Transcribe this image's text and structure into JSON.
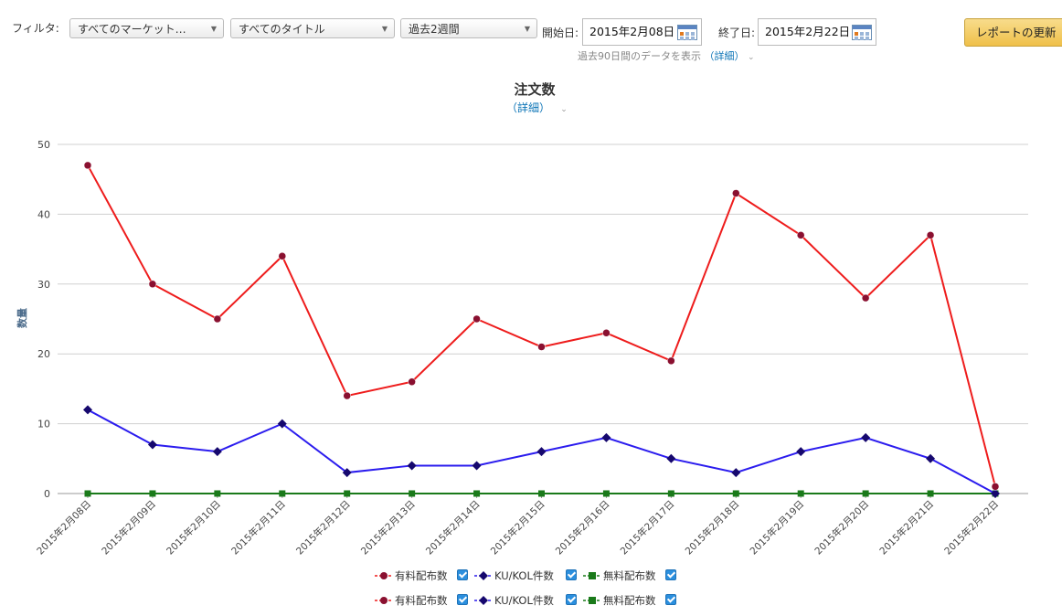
{
  "filters": {
    "label": "フィルタ:",
    "marketplace": "すべてのマーケット…",
    "title": "すべてのタイトル",
    "period": "過去2週間",
    "start_label": "開始日:",
    "start_date": "2015年2月08日",
    "end_label": "終了日:",
    "end_date": "2015年2月22日",
    "update_button": "レポートの更新",
    "note": "過去90日間のデータを表示",
    "details_link": "（詳細）"
  },
  "chart_details_link": "（詳細）",
  "colors": {
    "paid": "#ee1c1c",
    "paid_marker": "#8a1030",
    "ku": "#2b1cee",
    "ku_marker": "#16086e",
    "free": "#1a7a1a"
  },
  "chart_data": {
    "type": "line",
    "title": "注文数",
    "xlabel": "",
    "ylabel": "数量",
    "ylim": [
      0,
      50
    ],
    "yticks": [
      "0",
      "10",
      "20",
      "30",
      "40",
      "50"
    ],
    "grid": true,
    "legend_position": "bottom",
    "x": [
      "2015年2月08日",
      "2015年2月09日",
      "2015年2月10日",
      "2015年2月11日",
      "2015年2月12日",
      "2015年2月13日",
      "2015年2月14日",
      "2015年2月15日",
      "2015年2月16日",
      "2015年2月17日",
      "2015年2月18日",
      "2015年2月19日",
      "2015年2月20日",
      "2015年2月21日",
      "2015年2月22日"
    ],
    "series": [
      {
        "name": "有料配布数",
        "values": [
          47,
          30,
          25,
          34,
          14,
          16,
          25,
          21,
          23,
          19,
          43,
          37,
          28,
          37,
          1
        ],
        "marker": "circle"
      },
      {
        "name": "KU/KOL件数",
        "values": [
          12,
          7,
          6,
          10,
          3,
          4,
          4,
          6,
          8,
          5,
          3,
          6,
          8,
          5,
          0
        ],
        "marker": "diamond"
      },
      {
        "name": "無料配布数",
        "values": [
          0,
          0,
          0,
          0,
          0,
          0,
          0,
          0,
          0,
          0,
          0,
          0,
          0,
          0,
          0
        ],
        "marker": "square"
      }
    ]
  },
  "legend_rows": [
    [
      "有料配布数",
      "KU/KOL件数",
      "無料配布数"
    ],
    [
      "有料配布数",
      "KU/KOL件数",
      "無料配布数"
    ]
  ]
}
